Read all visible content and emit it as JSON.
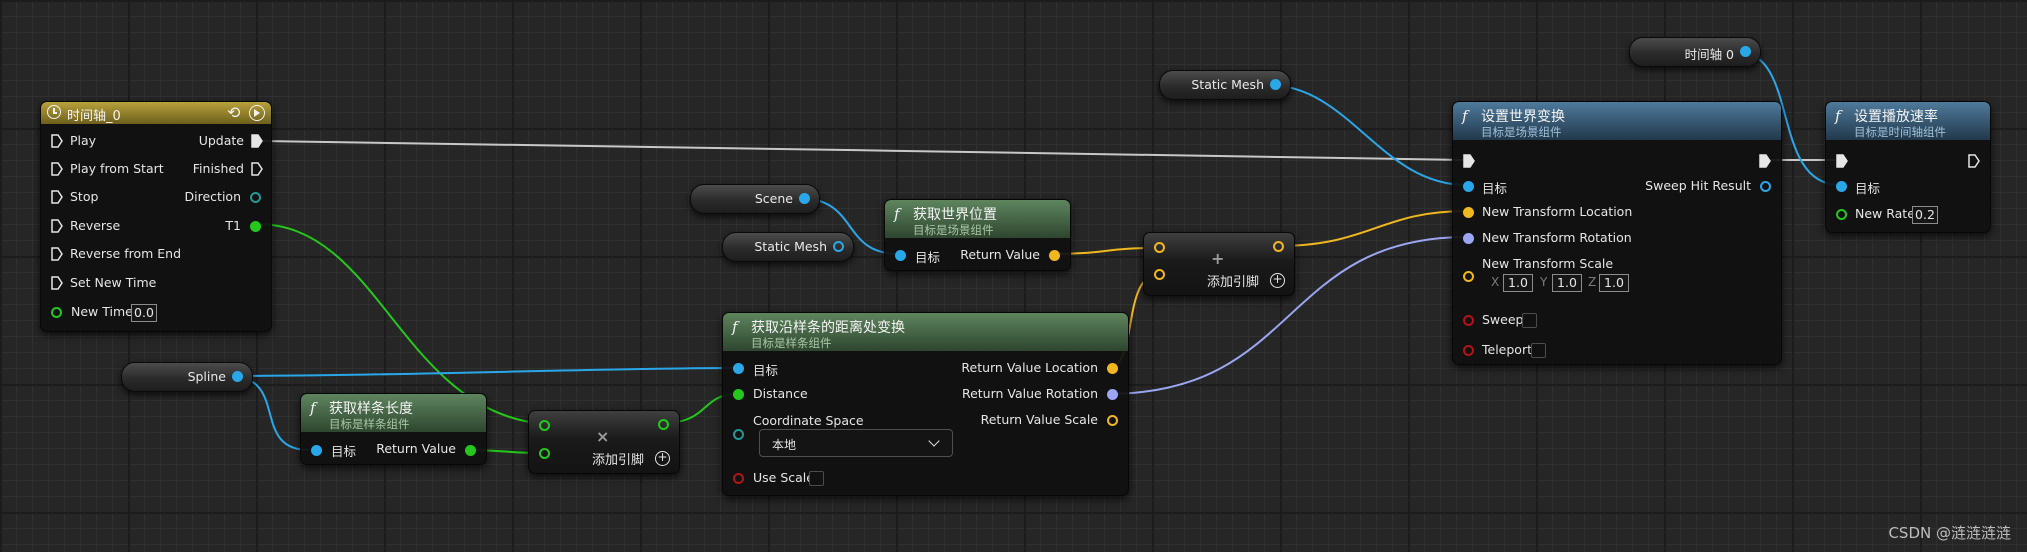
{
  "timeline_node": {
    "title": "时间轴_0",
    "inputs": [
      "Play",
      "Play from Start",
      "Stop",
      "Reverse",
      "Reverse from End",
      "Set New Time"
    ],
    "new_time_label": "New Time",
    "new_time_value": "0.0",
    "outputs": {
      "update": "Update",
      "finished": "Finished",
      "direction": "Direction",
      "t1": "T1"
    }
  },
  "spline_var": {
    "label": "Spline"
  },
  "spline_length_node": {
    "title": "获取样条长度",
    "subtitle": "目标是样条组件",
    "target": "目标",
    "return": "Return Value"
  },
  "multiply_node": {
    "label": "添加引脚",
    "symbol": "×"
  },
  "transform_node": {
    "title": "获取沿样条的距离处变换",
    "subtitle": "目标是样条组件",
    "target": "目标",
    "distance": "Distance",
    "coord_space": "Coordinate Space",
    "coord_value": "本地",
    "use_scale": "Use Scale",
    "out_location": "Return Value Location",
    "out_rotation": "Return Value Rotation",
    "out_scale": "Return Value Scale"
  },
  "scene_var": {
    "label": "Scene"
  },
  "static_mesh_var_a": {
    "label": "Static Mesh"
  },
  "world_location_node": {
    "title": "获取世界位置",
    "subtitle": "目标是场景组件",
    "target": "目标",
    "return": "Return Value"
  },
  "add_node": {
    "label": "添加引脚",
    "symbol": "+"
  },
  "static_mesh_var_b": {
    "label": "Static Mesh"
  },
  "set_transform_node": {
    "title": "设置世界变换",
    "subtitle": "目标是场景组件",
    "target": "目标",
    "sweep_hit": "Sweep Hit Result",
    "new_location": "New Transform Location",
    "new_rotation": "New Transform Rotation",
    "new_scale": "New Transform Scale",
    "scale_x_label": "X",
    "scale_x": "1.0",
    "scale_y_label": "Y",
    "scale_y": "1.0",
    "scale_z_label": "Z",
    "scale_z": "1.0",
    "sweep": "Sweep",
    "teleport": "Teleport"
  },
  "timeline_var": {
    "label": "时间轴 0"
  },
  "play_rate_node": {
    "title": "设置播放速率",
    "subtitle": "目标是时间轴组件",
    "target": "目标",
    "new_rate": "New Rate",
    "new_rate_value": "0.2"
  },
  "watermark": "CSDN @涟涟涟涟",
  "colors": {
    "object_pin": "#2aa7e8",
    "vector_pin": "#f1b71e",
    "float_pin": "#23c81b",
    "rotator_pin": "#9ba6f2",
    "bool_pin": "#b1141a",
    "exec_wire": "#d8d8d8",
    "timeline_header": "#9a8a2f",
    "pure_header": "#5e855e",
    "impure_header": "#4e7a9b"
  }
}
